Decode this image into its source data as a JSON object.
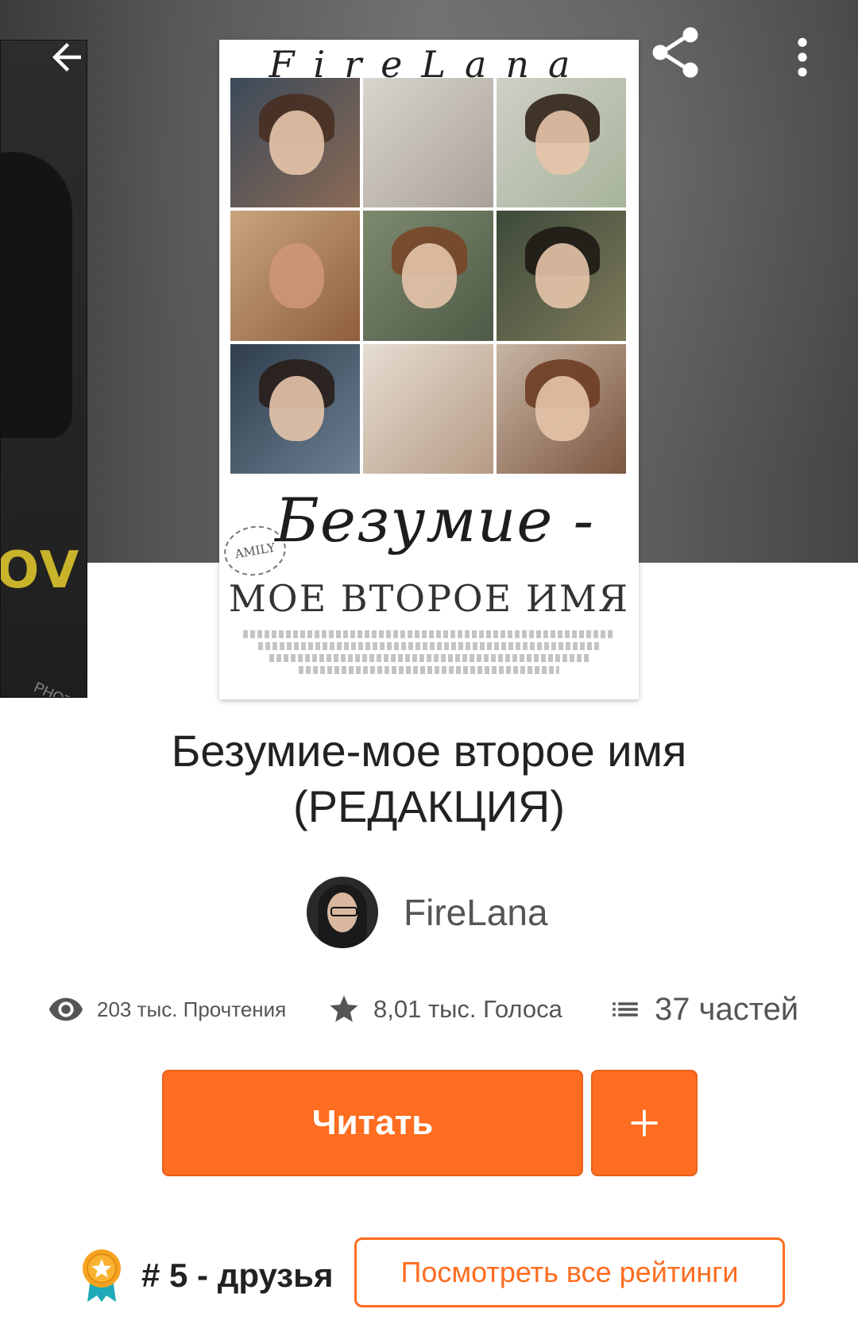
{
  "toolbar": {
    "back_icon": "arrow-left-icon",
    "share_icon": "share-icon",
    "more_icon": "more-vert-icon"
  },
  "left_cover": {
    "visible_text": "OV",
    "watermark": "PHOTA"
  },
  "cover": {
    "top_text": "FireLana",
    "script_title": "Безумие -",
    "stamp": "AMILY",
    "subtitle": "МОЕ ВТОРОЕ ИМЯ"
  },
  "story": {
    "title_line1": "Безумие-мое второе имя",
    "title_line2": "(РЕДАКЦИЯ)",
    "author": "FireLana"
  },
  "stats": {
    "reads": "203 тыс. Прочтения",
    "votes": "8,01 тыс. Голоса",
    "parts": "37 частей"
  },
  "actions": {
    "read_label": "Читать",
    "add_icon": "plus-icon"
  },
  "ranking": {
    "badge_icon": "rank-badge-icon",
    "text": "# 5 - друзья",
    "view_all_label": "Посмотреть все рейтинги"
  },
  "colors": {
    "accent": "#fe6d20",
    "text_primary": "#222222",
    "text_secondary": "#555555"
  }
}
